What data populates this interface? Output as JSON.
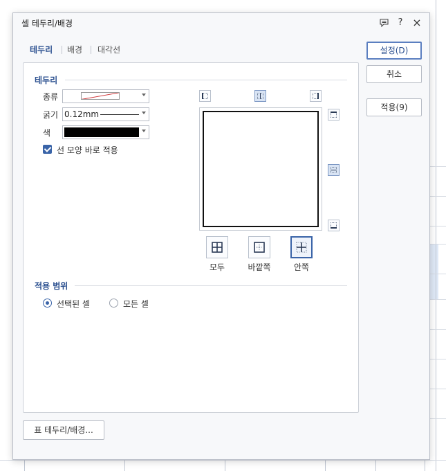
{
  "window": {
    "title": "셀 테두리/배경",
    "help_label": "?",
    "close_label": "×"
  },
  "tabs": [
    {
      "label": "테두리",
      "active": true
    },
    {
      "label": "배경",
      "active": false
    },
    {
      "label": "대각선",
      "active": false
    }
  ],
  "border_section": {
    "title": "테두리",
    "type_label": "종류",
    "thickness_label": "굵기",
    "thickness_value": "0.12mm",
    "color_label": "색",
    "color_value": "#000000",
    "apply_shape_checkbox": {
      "label": "선 모양 바로 적용",
      "checked": true
    }
  },
  "preset_buttons": [
    {
      "label": "모두",
      "icon": "border-all-icon"
    },
    {
      "label": "바깥쪽",
      "icon": "border-outside-icon"
    },
    {
      "label": "안쪽",
      "icon": "border-inside-icon",
      "active": true
    }
  ],
  "scope_section": {
    "title": "적용 범위",
    "options": [
      {
        "label": "선택된 셀",
        "selected": true
      },
      {
        "label": "모든 셀",
        "selected": false
      }
    ]
  },
  "buttons": {
    "ok_label": "설정(D)",
    "cancel_label": "취소",
    "apply_label": "적용(9)",
    "table_border_label": "표 테두리/배경..."
  },
  "colors": {
    "accent": "#3a64a8",
    "heading": "#2a4f8f"
  }
}
